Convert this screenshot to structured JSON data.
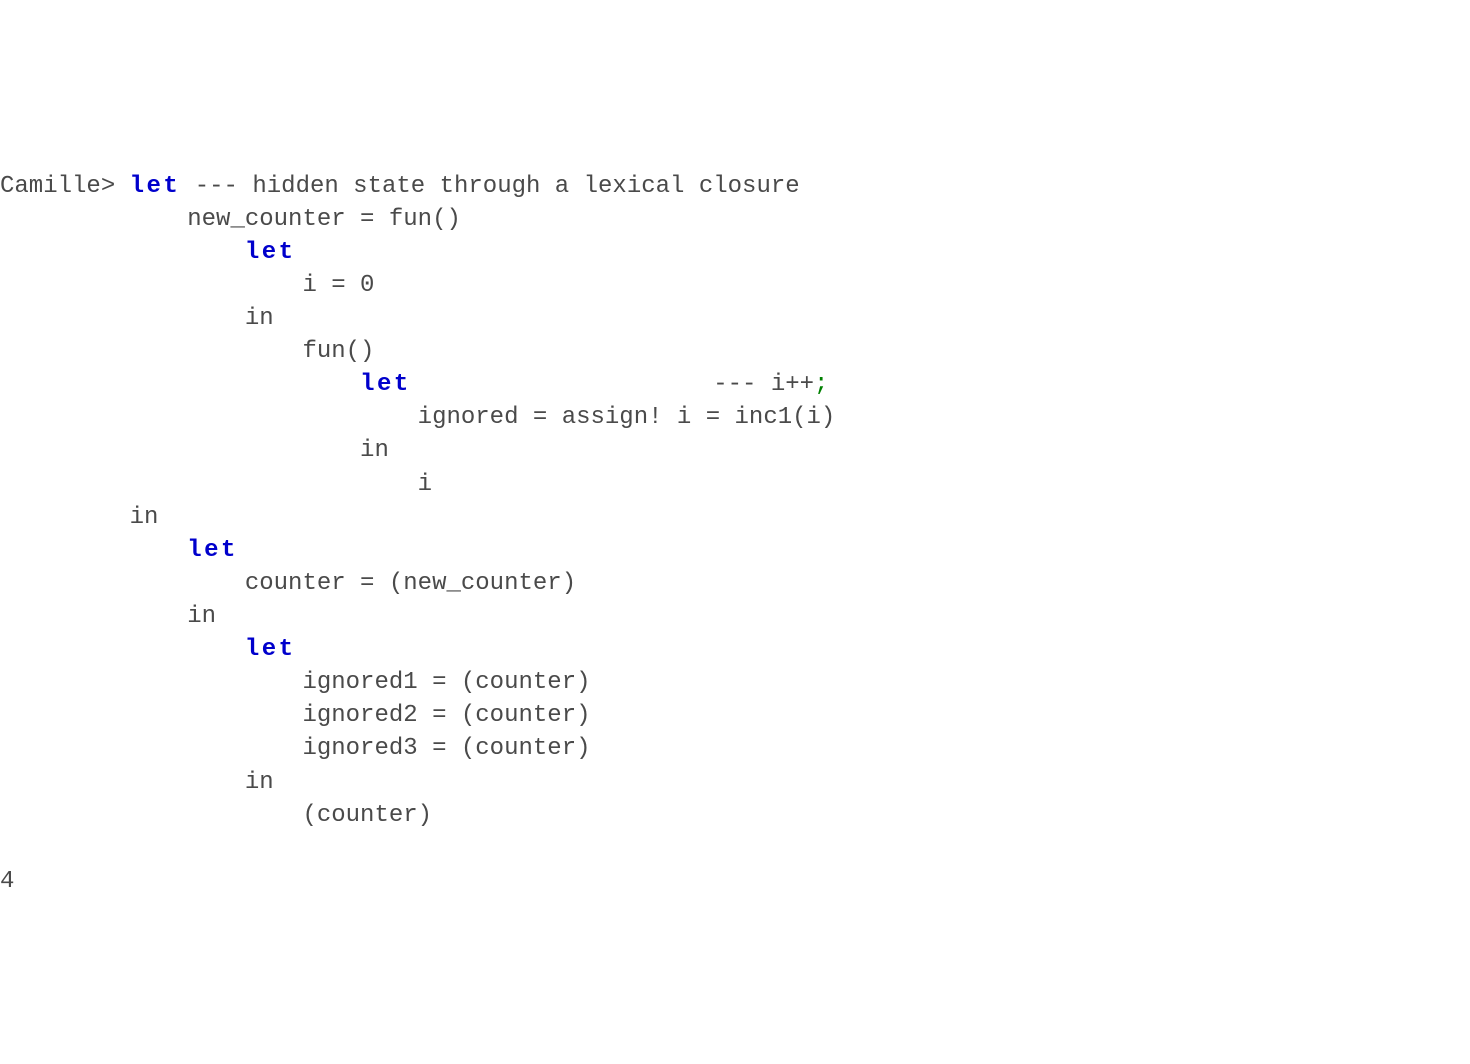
{
  "code": {
    "line01_a": "Camille> ",
    "line01_kw": "let",
    "line01_b": " --- hidden state through a lexical closure",
    "line02": "             new_counter = fun()",
    "line03_a": "                 ",
    "line03_kw": "let",
    "line04": "                     i = 0",
    "line05": "                 in",
    "line06": "                     fun()",
    "line07_a": "                         ",
    "line07_kw": "let",
    "line07_b": "                     --- i++",
    "line07_semi": ";",
    "line08": "                             ignored = assign! i = inc1(i)",
    "line09": "                         in",
    "line10": "                             i",
    "line11": "         in",
    "line12_a": "             ",
    "line12_kw": "let",
    "line13": "                 counter = (new_counter)",
    "line14": "             in",
    "line15_a": "                 ",
    "line15_kw": "let",
    "line16": "                     ignored1 = (counter)",
    "line17": "                     ignored2 = (counter)",
    "line18": "                     ignored3 = (counter)",
    "line19": "                 in",
    "line20": "                     (counter)",
    "blank": "",
    "result": "4"
  }
}
